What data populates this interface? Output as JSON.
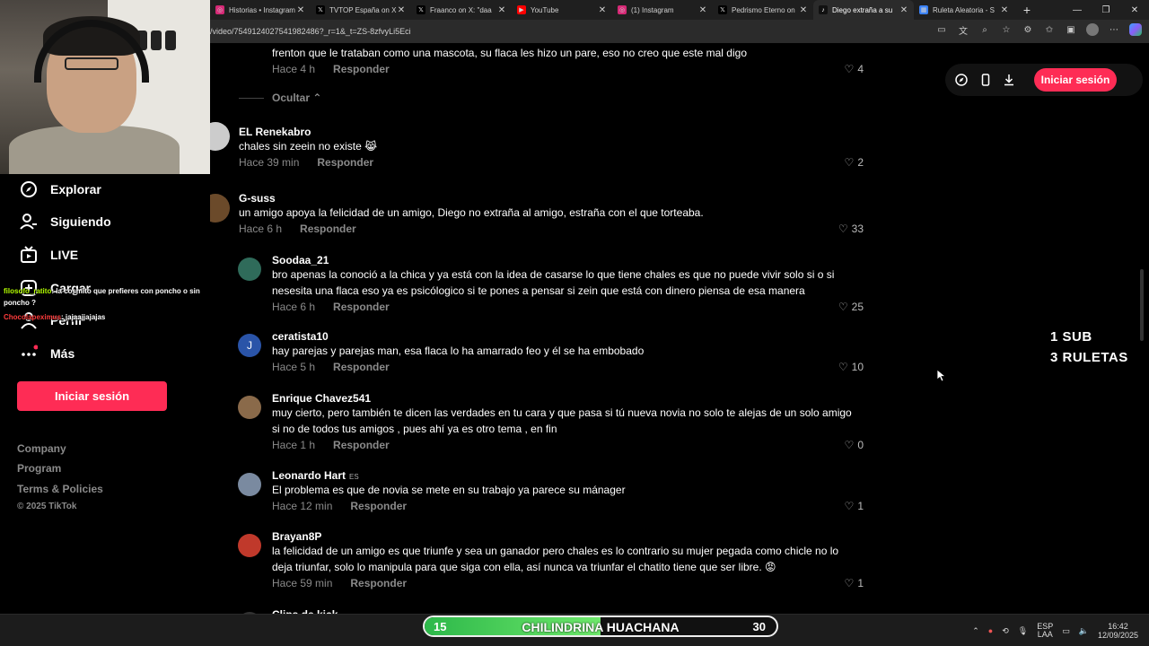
{
  "browser": {
    "tabs": [
      {
        "label": "Historias • Instagram",
        "fav_color": "#d62976",
        "fav_text": "◎"
      },
      {
        "label": "TVTOP España on X",
        "fav_color": "#000000",
        "fav_text": "𝕏"
      },
      {
        "label": "Fraanco on X: \"daa",
        "fav_color": "#000000",
        "fav_text": "𝕏"
      },
      {
        "label": "YouTube",
        "fav_color": "#ff0000",
        "fav_text": "▶"
      },
      {
        "label": "(1) Instagram",
        "fav_color": "#d62976",
        "fav_text": "◎"
      },
      {
        "label": "Pedrismo Eterno on",
        "fav_color": "#000000",
        "fav_text": "𝕏"
      },
      {
        "label": "Diego extraña a su",
        "fav_color": "#111111",
        "fav_text": "♪",
        "active": true
      },
      {
        "label": "Ruleta Aleatoria - S",
        "fav_color": "#3b82f6",
        "fav_text": "▦"
      }
    ],
    "url": "/video/7549124027541982486?_r=1&_t=ZS-8zfvyLi5Eci"
  },
  "sidebar": {
    "items": [
      {
        "label": "Explorar",
        "icon": "compass-icon"
      },
      {
        "label": "Siguiendo",
        "icon": "following-icon"
      },
      {
        "label": "LIVE",
        "icon": "live-icon"
      },
      {
        "label": "Cargar",
        "icon": "upload-icon"
      },
      {
        "label": "Perfil",
        "icon": "profile-icon"
      },
      {
        "label": "Más",
        "icon": "more-icon"
      }
    ],
    "login_label": "Iniciar sesión",
    "footer_links": [
      "Company",
      "Program",
      "Terms & Policies"
    ],
    "copyright": "© 2025 TikTok"
  },
  "stream_chat": [
    {
      "user": "filosofo_ratito",
      "text": ": la cosmito que prefieres con poncho o sin poncho ?",
      "user_color": "#b4ff00"
    },
    {
      "user": "Chocolapeximus",
      "text": ": jajaajjajajas",
      "user_color": "#ff3b3b"
    }
  ],
  "comments": {
    "hide_label": "Ocultar",
    "reply_label": "Responder",
    "top_partial": {
      "text": "frenton que le trataban como una mascota, su flaca les hizo un pare, eso no creo que este mal digo",
      "time": "Hace 4 h",
      "likes": "4"
    },
    "list": [
      {
        "user": "EL Renekabro",
        "lines": [
          "chales sin zeein no existe 😹"
        ],
        "time": "Hace 39 min",
        "likes": "2",
        "avatar_color": "#cccccc",
        "avatar_letter": ""
      },
      {
        "user": "G-suss",
        "lines": [
          "un amigo apoya la felicidad de un amigo, Diego no extraña al amigo, estraña con el que torteaba."
        ],
        "time": "Hace 6 h",
        "likes": "33",
        "avatar_color": "#6b4a2a",
        "avatar_letter": ""
      },
      {
        "user": "Soodaa_21",
        "lines": [
          "bro apenas la conoció a la chica y ya está con la idea de casarse lo que tiene chales es que no puede vivir solo si o si",
          "nesesita una flaca eso ya es psicólogico si te pones a pensar si zein que está con dinero piensa de esa manera"
        ],
        "time": "Hace 6 h",
        "likes": "25",
        "avatar_color": "#2f6b5a",
        "avatar_letter": ""
      },
      {
        "user": "ceratista10",
        "lines": [
          "hay parejas y parejas man, esa flaca lo ha amarrado feo y él se ha embobado"
        ],
        "time": "Hace 5 h",
        "likes": "10",
        "avatar_color": "#2a54a8",
        "avatar_letter": "J"
      },
      {
        "user": "Enrique Chavez541",
        "lines": [
          "muy cierto, pero también te dicen las verdades en tu cara y que pasa si tú nueva novia no solo te alejas de un solo amigo",
          "si no de todos tus amigos , pues ahí ya es otro tema , en fin"
        ],
        "time": "Hace 1 h",
        "likes": "0",
        "avatar_color": "#8a6a4a",
        "avatar_letter": ""
      },
      {
        "user": "Leonardo Hart",
        "tag": "ES",
        "lines": [
          "El problema es que de novia se mete en su trabajo ya parece su mánager"
        ],
        "time": "Hace 12 min",
        "likes": "1",
        "avatar_color": "#7a8aa0",
        "avatar_letter": ""
      },
      {
        "user": "Brayan8P",
        "lines": [
          "la felicidad de un amigo es que triunfe y sea un ganador pero chales es lo contrario su mujer pegada como chicle no lo",
          "deja triunfar, solo lo manipula para que siga con ella, así nunca va triunfar el chatito tiene que ser libre. 😡"
        ],
        "time": "Hace 59 min",
        "likes": "1",
        "avatar_color": "#c0392b",
        "avatar_letter": ""
      },
      {
        "user": "Clips de kick",
        "lines": [],
        "time": "",
        "likes": "",
        "avatar_color": "#333333",
        "avatar_letter": ""
      }
    ]
  },
  "top_controls": {
    "login_label": "Iniciar sesión"
  },
  "promo": {
    "line1": "1 SUB",
    "line2": "3 RULETAS"
  },
  "goal": {
    "left": "15",
    "title": "CHILINDRINA HUACHANA",
    "right": "30",
    "progress": 0.5
  },
  "taskbar": {
    "lang_top": "ESP",
    "lang_bottom": "LAA",
    "time": "16:42",
    "date": "12/09/2025"
  },
  "colors": {
    "accent": "#fe2c55",
    "background": "#000000"
  }
}
